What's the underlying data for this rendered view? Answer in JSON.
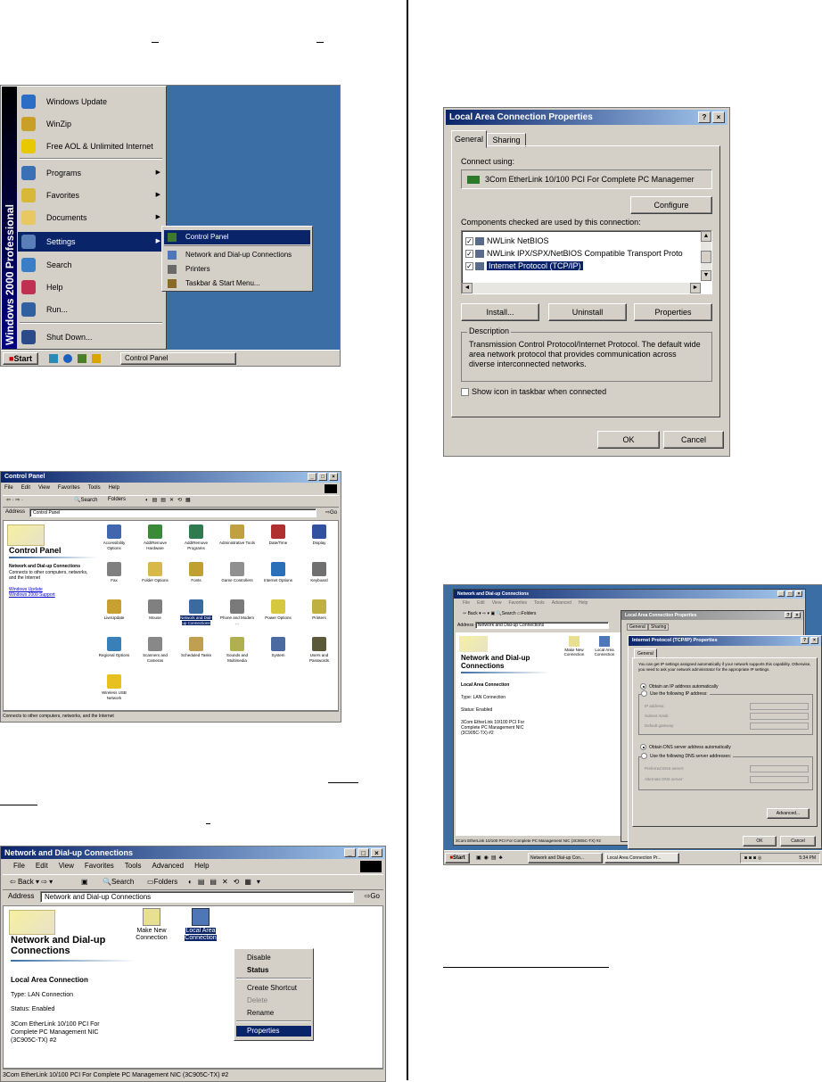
{
  "startmenu": {
    "brand": "Windows 2000 Professional",
    "items": [
      "Windows Update",
      "WinZip",
      "Free AOL & Unlimited Internet",
      "Programs",
      "Favorites",
      "Documents",
      "Settings",
      "Search",
      "Help",
      "Run...",
      "Shut Down..."
    ],
    "submenu": [
      "Control Panel",
      "Network and Dial-up Connections",
      "Printers",
      "Taskbar & Start Menu..."
    ],
    "start_label": "Start",
    "task_label": "Control Panel"
  },
  "controlpanel": {
    "title": "Control Panel",
    "menu": [
      "File",
      "Edit",
      "View",
      "Favorites",
      "Tools",
      "Help"
    ],
    "address_label": "Address",
    "address_value": "Control Panel",
    "go_label": "Go",
    "side_title": "Control Panel",
    "side_heading": "Network and Dial-up Connections",
    "side_text": "Connects to other computers, networks, and the Internet",
    "side_links": [
      "Windows Update",
      "Windows 2000 Support"
    ],
    "icons": [
      "Accessibility Options",
      "Add/Remove Hardware",
      "Add/Remove Programs",
      "Administrative Tools",
      "Date/Time",
      "Display",
      "Fax",
      "Folder Options",
      "Fonts",
      "Game Controllers",
      "Internet Options",
      "Keyboard",
      "LiveUpdate",
      "Mouse",
      "Network and Dial-up Connections",
      "Phone and Modem ...",
      "Power Options",
      "Printers",
      "Regional Options",
      "Scanners and Cameras",
      "Scheduled Tasks",
      "Sounds and Multimedia",
      "System",
      "Users and Passwords",
      "Wireless USB Network"
    ],
    "status": "Connects to other computers, networks, and the Internet"
  },
  "netconn": {
    "title": "Network and Dial-up Connections",
    "menu": [
      "File",
      "Edit",
      "View",
      "Favorites",
      "Tools",
      "Advanced",
      "Help"
    ],
    "toolbar": [
      "Back",
      "Search",
      "Folders"
    ],
    "address_label": "Address",
    "address_value": "Network and Dial-up Connections",
    "go_label": "Go",
    "side_title": "Network and Dial-up Connections",
    "conn_title": "Local Area Connection",
    "conn_type": "Type: LAN Connection",
    "conn_status": "Status: Enabled",
    "conn_desc": "3Com EtherLink 10/100 PCI For Complete PC Management NIC (3C905C-TX) #2",
    "icon_new": "Make New Connection",
    "icon_lan": "Local Area Connection",
    "context": [
      "Disable",
      "Status",
      "Create Shortcut",
      "Delete",
      "Rename",
      "Properties"
    ],
    "status": "3Com EtherLink 10/100 PCI For Complete PC Management NIC (3C905C-TX) #2"
  },
  "lanprops": {
    "title": "Local Area Connection Properties",
    "tabs": [
      "General",
      "Sharing"
    ],
    "connect_using": "Connect using:",
    "adapter": "3Com EtherLink 10/100 PCI For Complete PC Managemer",
    "configure": "Configure",
    "components_label": "Components checked are used by this connection:",
    "components": [
      "NWLink NetBIOS",
      "NWLink IPX/SPX/NetBIOS Compatible Transport Proto",
      "Internet Protocol (TCP/IP)"
    ],
    "install": "Install...",
    "uninstall": "Uninstall",
    "properties": "Properties",
    "description_label": "Description",
    "description": "Transmission Control Protocol/Internet Protocol. The default wide area network protocol that provides communication across diverse interconnected networks.",
    "show_icon": "Show icon in taskbar when connected",
    "ok": "OK",
    "cancel": "Cancel"
  },
  "tcpip": {
    "bg_title": "Network and Dial-up Connections",
    "bg_menu": [
      "File",
      "Edit",
      "View",
      "Favorites",
      "Tools",
      "Advanced",
      "Help"
    ],
    "bg_address": "Network and Dial-up Connections",
    "bg_side_title": "Network and Dial-up Connections",
    "bg_conn_title": "Local Area Connection",
    "bg_conn_type": "Type: LAN Connection",
    "bg_conn_status": "Status: Enabled",
    "bg_conn_desc": "3Com EtherLink 10/100 PCI For Complete PC Management NIC (3C905C-TX) #2",
    "bg_icon_new": "Make New Connection",
    "bg_icon_lan": "Local Area Connection",
    "bg_status": "3Com EtherLink 10/100 PCI For Complete PC Management NIC (3C905C-TX) #2",
    "lan_title": "Local Area Connection Properties",
    "lan_tabs": [
      "General",
      "Sharing"
    ],
    "title": "Internet Protocol (TCP/IP) Properties",
    "tab": "General",
    "intro": "You can get IP settings assigned automatically if your network supports this capability. Otherwise, you need to ask your network administrator for the appropriate IP settings.",
    "obtain_ip": "Obtain an IP address automatically",
    "use_ip": "Use the following IP address:",
    "ip_fields": [
      "IP address:",
      "Subnet mask:",
      "Default gateway:"
    ],
    "obtain_dns": "Obtain DNS server address automatically",
    "use_dns": "Use the following DNS server addresses:",
    "dns_fields": [
      "Preferred DNS server:",
      "Alternate DNS server:"
    ],
    "advanced": "Advanced...",
    "ok": "OK",
    "cancel": "Cancel",
    "start_label": "Start",
    "tasks": [
      "Network and Dial-up Con...",
      "Local Area Connection Pr..."
    ],
    "clock": "5:34 PM"
  },
  "colors": {
    "title_dark": "#0a246a",
    "title_light": "#a6caf0",
    "chrome": "#d4d0c8",
    "desktop": "#3a6ea5",
    "select": "#0a246a"
  }
}
